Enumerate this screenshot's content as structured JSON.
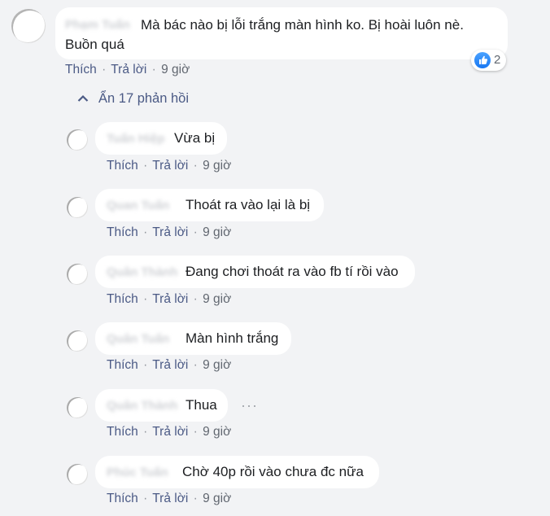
{
  "main_comment": {
    "text_line1": "Mà bác nào bị lỗi trắng màn hình ko. Bị hoài luôn nè.",
    "text_line2": "Buồn quá",
    "blurred_name": "Phạm Tuấn",
    "actions": {
      "like": "Thích",
      "reply": "Trả lời",
      "time": "9 giờ",
      "sep": "·"
    },
    "reaction_count": "2"
  },
  "replies_toggle": {
    "chevron": "⌃",
    "label": "Ẩn 17 phản hồi"
  },
  "more_options": "···",
  "replies": [
    {
      "name": "Tuấn Hiệp",
      "text": "Vừa bị",
      "like": "Thích",
      "reply": "Trả lời",
      "time": "9 giờ",
      "sep": "·"
    },
    {
      "name": "Quan Tuấn",
      "text": "Thoát ra vào lại là bị",
      "like": "Thích",
      "reply": "Trả lời",
      "time": "9 giờ",
      "sep": "·"
    },
    {
      "name": "Quân Thành",
      "text": "Đang chơi thoát ra vào fb tí rồi vào",
      "like": "Thích",
      "reply": "Trả lời",
      "time": "9 giờ",
      "sep": "·"
    },
    {
      "name": "Quân Tuấn",
      "text": "Màn hình trắng",
      "like": "Thích",
      "reply": "Trả lời",
      "time": "9 giờ",
      "sep": "·"
    },
    {
      "name": "Quân Thành",
      "text": "Thua",
      "like": "Thích",
      "reply": "Trả lời",
      "time": "9 giờ",
      "sep": "·"
    },
    {
      "name": "Phúc Tuấn",
      "text": "Chờ 40p rồi vào chưa đc nữa",
      "like": "Thích",
      "reply": "Trả lời",
      "time": "9 giờ",
      "sep": "·"
    }
  ]
}
